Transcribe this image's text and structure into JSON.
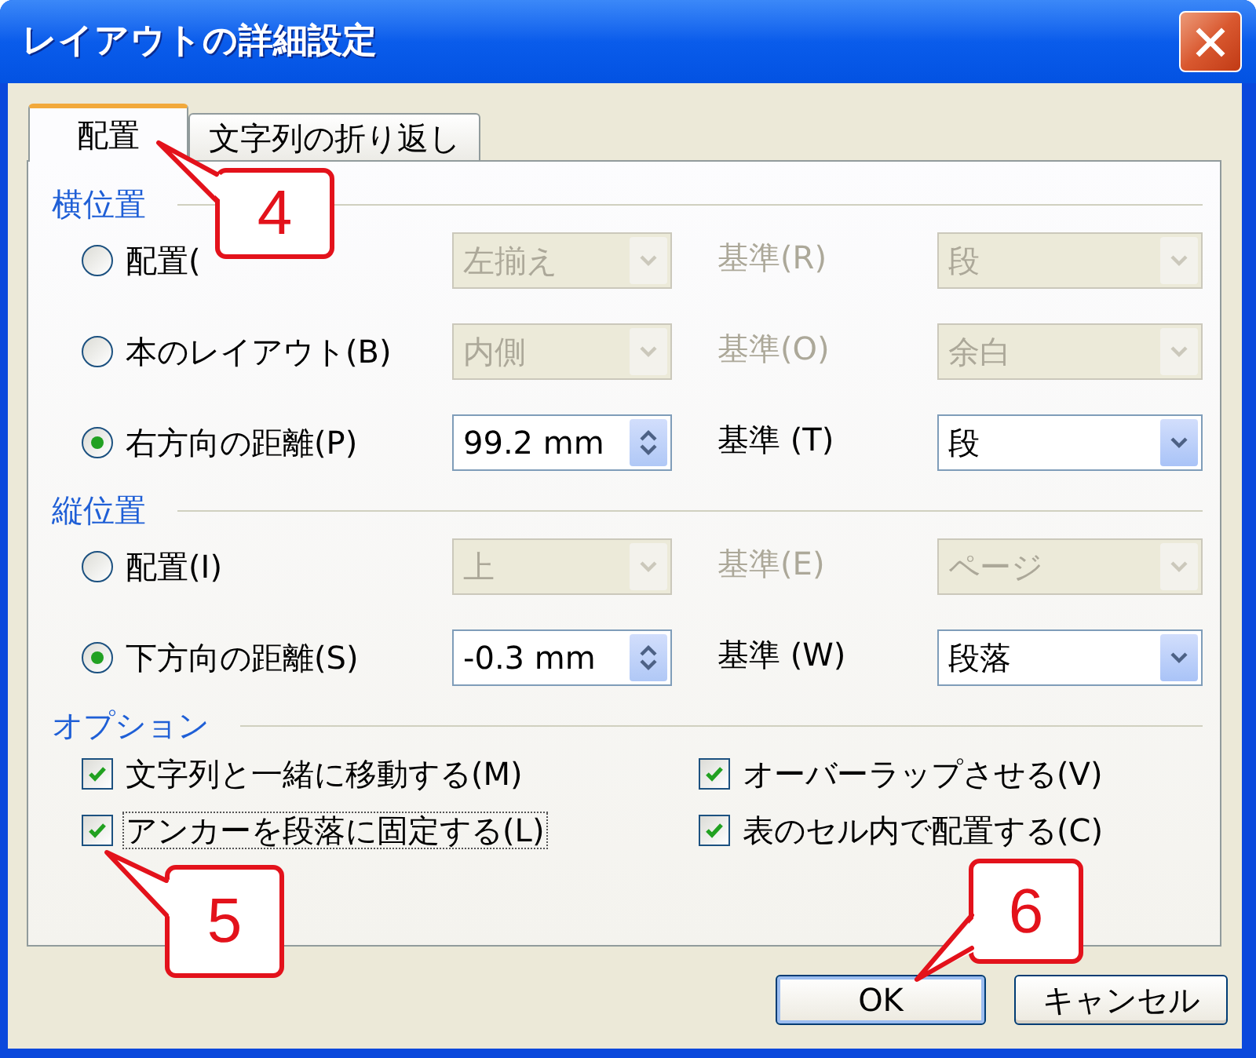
{
  "window": {
    "title": "レイアウトの詳細設定"
  },
  "tabs": [
    {
      "label": "配置",
      "selected": true
    },
    {
      "label": "文字列の折り返し",
      "selected": false
    }
  ],
  "sections": [
    {
      "title": "横位置",
      "rows": [
        {
          "label": "配置(",
          "selected": false,
          "disabled": true,
          "field": {
            "kind": "dropdown",
            "value": "左揃え"
          },
          "ref_label": "基準(R)",
          "ref_value": "段"
        },
        {
          "label": "本のレイアウト(B)",
          "selected": false,
          "disabled": true,
          "field": {
            "kind": "dropdown",
            "value": "内側"
          },
          "ref_label": "基準(O)",
          "ref_value": "余白"
        },
        {
          "label": "右方向の距離(P)",
          "selected": true,
          "disabled": false,
          "field": {
            "kind": "spinner",
            "value": "99.2 mm"
          },
          "ref_label": "基準 (T)",
          "ref_value": "段"
        }
      ]
    },
    {
      "title": "縦位置",
      "rows": [
        {
          "label": "配置(I)",
          "selected": false,
          "disabled": true,
          "field": {
            "kind": "dropdown",
            "value": "上"
          },
          "ref_label": "基準(E)",
          "ref_value": "ページ"
        },
        {
          "label": "下方向の距離(S)",
          "selected": true,
          "disabled": false,
          "field": {
            "kind": "spinner",
            "value": "-0.3 mm"
          },
          "ref_label": "基準 (W)",
          "ref_value": "段落"
        }
      ]
    }
  ],
  "options": {
    "title": "オプション",
    "checkboxes": [
      {
        "label": "文字列と一緒に移動する(M)",
        "checked": true,
        "focused": false
      },
      {
        "label": "オーバーラップさせる(V)",
        "checked": true,
        "focused": false
      },
      {
        "label": "アンカーを段落に固定する(L)",
        "checked": true,
        "focused": true
      },
      {
        "label": "表のセル内で配置する(C)",
        "checked": true,
        "focused": false
      }
    ]
  },
  "buttons": [
    {
      "label": "OK",
      "default": true
    },
    {
      "label": "キャンセル",
      "default": false
    }
  ],
  "callouts": [
    {
      "text": "4"
    },
    {
      "text": "5"
    },
    {
      "text": "6"
    }
  ]
}
